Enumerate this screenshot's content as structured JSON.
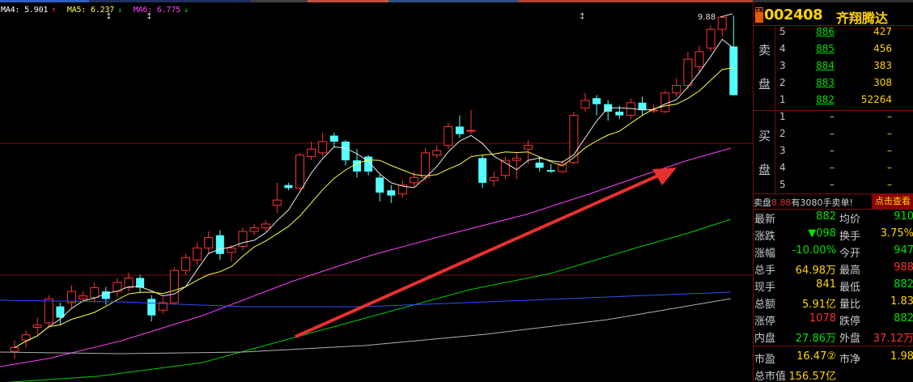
{
  "colors": {
    "up": "#ff3232",
    "down": "#54ffff",
    "ma_white": "#e8e8e8",
    "ma_yellow": "#ffff40",
    "ma_magenta": "#ff40ff",
    "ma_green": "#00d000",
    "ma_blue": "#3050ff",
    "ma_gray": "#b0b0b0",
    "grid": "#7a1010",
    "price_green": "#00e000",
    "text_yellow": "#ffd400",
    "text_red": "#ff3030"
  },
  "ma_legend": [
    {
      "label": "MA4: 5.901",
      "arrow": "↑",
      "color": "#ffffff"
    },
    {
      "label": "MA5: 6.237",
      "arrow": "↓",
      "color": "#ffff40"
    },
    {
      "label": "MA6: 6.775",
      "arrow": "↓",
      "color": "#ff40ff"
    }
  ],
  "chart_labels": {
    "high_label": "9.88"
  },
  "stock": {
    "badge": "TR",
    "code": "002408",
    "name": "齐翔腾达"
  },
  "order_book": {
    "sell_label_top": "卖",
    "sell_label_bottom": "盘",
    "buy_label_top": "买",
    "buy_label_bottom": "盘",
    "sell": [
      {
        "level": "5",
        "price": "886",
        "vol": "427"
      },
      {
        "level": "4",
        "price": "885",
        "vol": "456"
      },
      {
        "level": "3",
        "price": "884",
        "vol": "383"
      },
      {
        "level": "2",
        "price": "883",
        "vol": "308"
      },
      {
        "level": "1",
        "price": "882",
        "vol": "52264"
      }
    ],
    "buy": [
      {
        "level": "1",
        "price": "–",
        "vol": "–"
      },
      {
        "level": "2",
        "price": "–",
        "vol": "–"
      },
      {
        "level": "3",
        "price": "–",
        "vol": "–"
      },
      {
        "level": "4",
        "price": "–",
        "vol": "–"
      },
      {
        "level": "5",
        "price": "–",
        "vol": "–"
      }
    ]
  },
  "notice": {
    "prefix": "卖盘",
    "price": "8.88",
    "suffix": "有3080手卖单!",
    "button": "点击查看"
  },
  "quotes": [
    {
      "l1": "最新",
      "v1": "882",
      "c1": "#00e000",
      "l2": "均价",
      "v2": "910",
      "c2": "#00e000"
    },
    {
      "l1": "涨跌",
      "v1": "▼098",
      "c1": "#00e000",
      "l2": "换手",
      "v2": "3.75%",
      "c2": "#ffd400"
    },
    {
      "l1": "涨幅",
      "v1": "-10.00%",
      "c1": "#00e000",
      "l2": "今开",
      "v2": "947",
      "c2": "#00e000"
    },
    {
      "l1": "总手",
      "v1": "64.98万",
      "c1": "#ffd400",
      "l2": "最高",
      "v2": "988",
      "c2": "#ff3030"
    },
    {
      "l1": "现手",
      "v1": "841",
      "c1": "#ffd400",
      "l2": "最低",
      "v2": "882",
      "c2": "#00e000"
    },
    {
      "l1": "总额",
      "v1": "5.91亿",
      "c1": "#ffd400",
      "l2": "量比",
      "v2": "1.83",
      "c2": "#ffd400"
    },
    {
      "l1": "涨停",
      "v1": "1078",
      "c1": "#ff3030",
      "l2": "跌停",
      "v2": "882",
      "c2": "#00e000"
    },
    {
      "l1": "内盘",
      "v1": "27.86万",
      "c1": "#00e000",
      "l2": "外盘",
      "v2": "37.12万",
      "c2": "#ff3030"
    },
    {
      "l1": "市盈",
      "v1": "16.47②",
      "c1": "#ffd400",
      "l2": "市净",
      "v2": "1.98",
      "c2": "#ffd400"
    },
    {
      "l1": "总市值",
      "v1": "156.57亿",
      "c1": "#ffd400",
      "l2": "",
      "v2": "",
      "c2": "#ffd400"
    }
  ]
}
